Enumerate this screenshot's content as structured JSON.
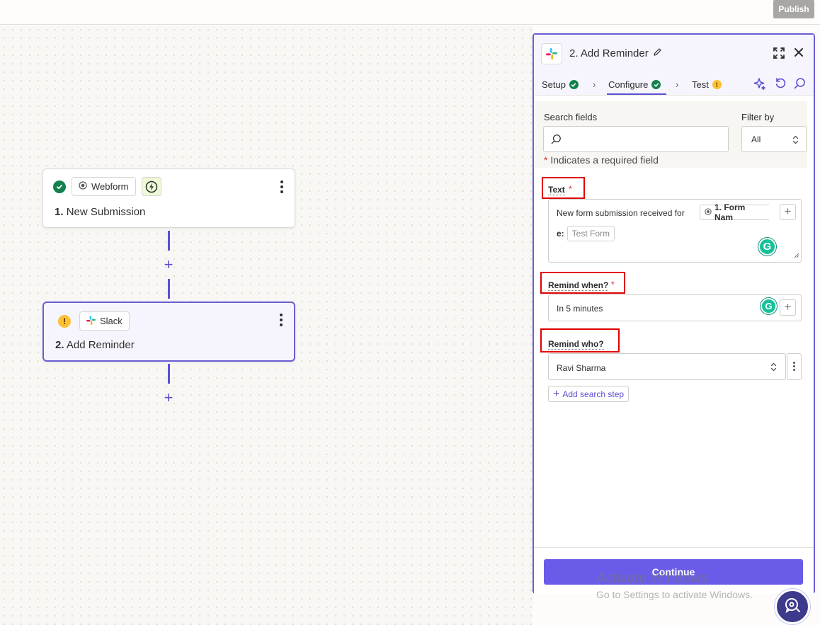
{
  "topbar": {
    "publish_label": "Publish"
  },
  "nodes": [
    {
      "app": "Webform",
      "number": "1.",
      "title": "New Submission",
      "status": "complete"
    },
    {
      "app": "Slack",
      "number": "2.",
      "title": "Add Reminder",
      "status": "warning"
    }
  ],
  "panel": {
    "title": "2. Add Reminder",
    "tabs": [
      {
        "label": "Setup",
        "status": "complete"
      },
      {
        "label": "Configure",
        "status": "complete"
      },
      {
        "label": "Test",
        "status": "warning"
      }
    ],
    "search": {
      "label": "Search fields",
      "placeholder": "",
      "filter_label": "Filter by",
      "filter_value": "All"
    },
    "required_note": "Indicates a required field",
    "fields": {
      "text": {
        "label": "Text",
        "static_text": "New form submission received for",
        "pill_label": "1. Form Nam",
        "pill_continuation": "e:",
        "pill_value": "Test Form"
      },
      "remind_when": {
        "label": "Remind when?",
        "value": "In 5 minutes"
      },
      "remind_who": {
        "label": "Remind who?",
        "value": "Ravi Sharma"
      }
    },
    "add_search_step_label": "Add search step",
    "continue_label": "Continue"
  },
  "watermark": {
    "line1": "Activate Windows",
    "line2": "Go to Settings to activate Windows."
  },
  "colors": {
    "accent": "#5b4fd1",
    "success": "#13814c",
    "warning": "#fdc033",
    "required": "#d92b2b",
    "highlight_box": "#e00000"
  }
}
